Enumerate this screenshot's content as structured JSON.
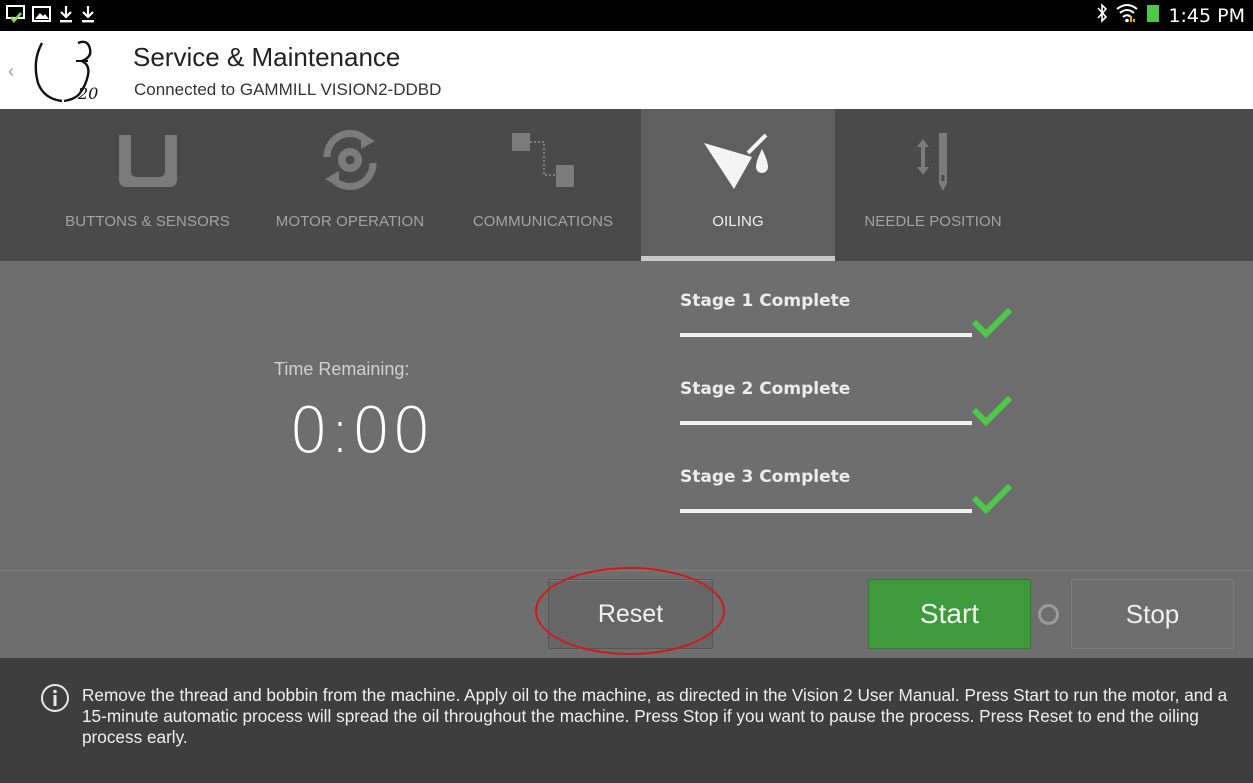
{
  "status_bar": {
    "left_icons": [
      "notification-check-icon",
      "gallery-icon",
      "download-icon",
      "download-icon"
    ],
    "right_icons": [
      "bluetooth-icon",
      "wifi-icon",
      "battery-icon"
    ],
    "time": "1:45 PM"
  },
  "header": {
    "title": "Service & Maintenance",
    "subtitle": "Connected to GAMMILL VISION2-DDBD",
    "logo": "q20-logo"
  },
  "tabs": [
    {
      "label": "BUTTONS & SENSORS",
      "icon": "u-sensor-icon",
      "active": false
    },
    {
      "label": "MOTOR OPERATION",
      "icon": "motor-rotate-icon",
      "active": false
    },
    {
      "label": "COMMUNICATIONS",
      "icon": "communications-icon",
      "active": false
    },
    {
      "label": "OILING",
      "icon": "oil-can-icon",
      "active": true
    },
    {
      "label": "NEEDLE POSITION",
      "icon": "needle-position-icon",
      "active": false
    }
  ],
  "timer": {
    "label": "Time Remaining:",
    "value": "0:00"
  },
  "stages": [
    {
      "label": "Stage 1 Complete",
      "progress": 1.0,
      "complete": true
    },
    {
      "label": "Stage 2 Complete",
      "progress": 1.0,
      "complete": true
    },
    {
      "label": "Stage 3 Complete",
      "progress": 1.0,
      "complete": true
    }
  ],
  "buttons": {
    "reset": "Reset",
    "start": "Start",
    "stop": "Stop"
  },
  "info": {
    "icon": "info-icon",
    "text": "Remove the thread and bobbin from the machine. Apply oil to the machine, as directed in the Vision 2 User Manual. Press Start to run the motor, and a 15-minute automatic process will spread the oil throughout the machine. Press Stop if you want to pause the process. Press Reset to end the oiling process early."
  },
  "colors": {
    "tab_bar": "#4a4a4a",
    "tab_active": "#5f5f5f",
    "content_bg": "#6e6e6e",
    "start_green": "#3e9a3b",
    "check_green": "#4cc84a",
    "annotation_red": "#d01a1a",
    "info_bg": "#3e3e3e"
  }
}
